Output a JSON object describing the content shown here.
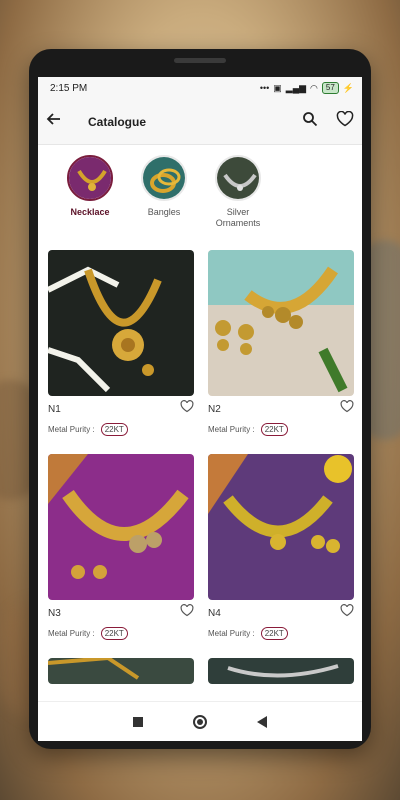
{
  "status_bar": {
    "time": "2:15 PM",
    "icons": [
      "sim-icon",
      "signal-icon",
      "wifi-icon"
    ],
    "battery": "57"
  },
  "header": {
    "title": "Catalogue",
    "back_icon": "arrow-left-icon",
    "search_icon": "search-icon",
    "wishlist_icon": "heart-outline-icon"
  },
  "categories": [
    {
      "label": "Necklace",
      "active": true
    },
    {
      "label": "Bangles",
      "active": false
    },
    {
      "label": "Silver Ornaments",
      "active": false
    }
  ],
  "products": [
    {
      "name": "N1",
      "purity_label": "Metal Purity :",
      "purity": "22KT"
    },
    {
      "name": "N2",
      "purity_label": "Metal Purity :",
      "purity": "22KT"
    },
    {
      "name": "N3",
      "purity_label": "Metal Purity :",
      "purity": "22KT"
    },
    {
      "name": "N4",
      "purity_label": "Metal Purity :",
      "purity": "22KT"
    }
  ],
  "nav_bar": {
    "icons": [
      "recents-square-icon",
      "home-circle-icon",
      "back-triangle-icon"
    ]
  },
  "colors": {
    "accent": "#7a1d3d",
    "badge_border": "#8a1c3a"
  }
}
